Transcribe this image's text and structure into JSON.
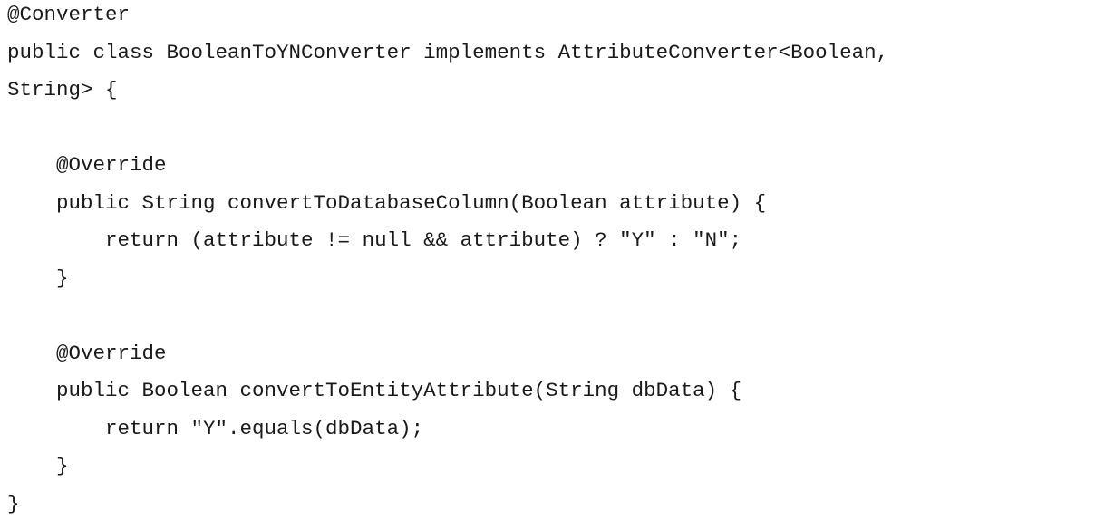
{
  "code": {
    "lines": [
      "@Converter",
      "public class BooleanToYNConverter implements AttributeConverter<Boolean,",
      "String> {",
      "",
      "    @Override",
      "    public String convertToDatabaseColumn(Boolean attribute) {",
      "        return (attribute != null && attribute) ? \"Y\" : \"N\";",
      "    }",
      "",
      "    @Override",
      "    public Boolean convertToEntityAttribute(String dbData) {",
      "        return \"Y\".equals(dbData);",
      "    }",
      "}"
    ]
  }
}
